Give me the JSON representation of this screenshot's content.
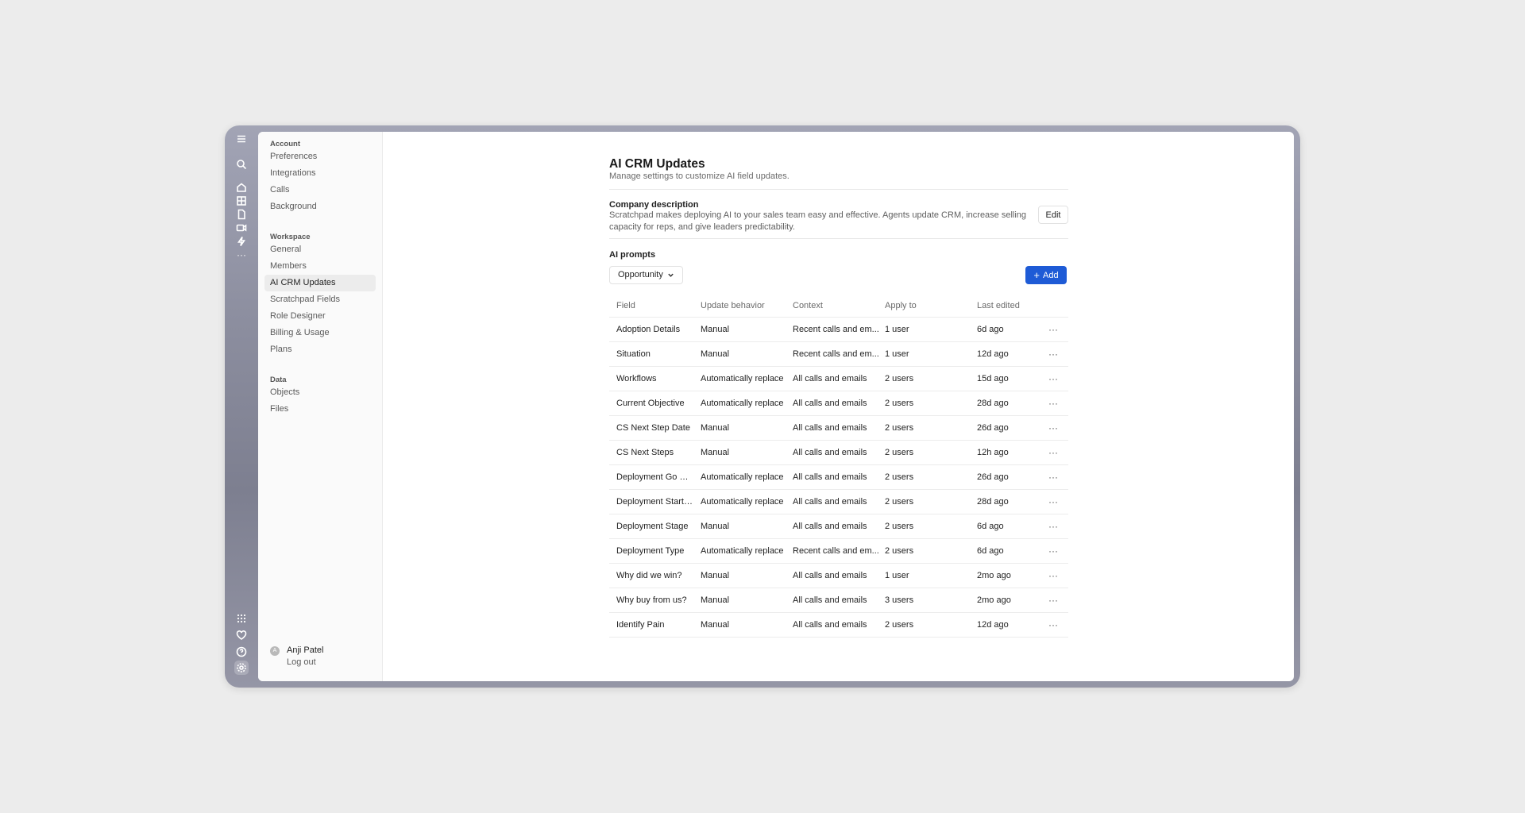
{
  "rail": {
    "icons": [
      "menu-icon",
      "search-icon",
      "home-icon",
      "grid-icon",
      "document-icon",
      "video-icon",
      "bolt-icon",
      "more-icon",
      "apps-icon",
      "heart-icon",
      "help-icon",
      "settings-icon"
    ],
    "more_glyph": "···"
  },
  "nav": {
    "groups": [
      {
        "title": "Account",
        "items": [
          "Preferences",
          "Integrations",
          "Calls",
          "Background"
        ]
      },
      {
        "title": "Workspace",
        "items": [
          "General",
          "Members",
          "AI CRM Updates",
          "Scratchpad Fields",
          "Role Designer",
          "Billing & Usage",
          "Plans"
        ]
      },
      {
        "title": "Data",
        "items": [
          "Objects",
          "Files"
        ]
      }
    ],
    "active_item": "AI CRM Updates",
    "user": {
      "initial": "A",
      "name": "Anji Patel",
      "logout": "Log out"
    }
  },
  "page": {
    "title": "AI CRM Updates",
    "subtitle": "Manage settings to customize AI field updates.",
    "company": {
      "label": "Company description",
      "text": "Scratchpad makes deploying AI to your sales team easy and effective. Agents update CRM, increase selling capacity for reps, and give leaders predictability.",
      "edit_label": "Edit"
    },
    "prompts_label": "AI prompts",
    "filter_value": "Opportunity",
    "add_label": "Add"
  },
  "table": {
    "headers": {
      "field": "Field",
      "update": "Update behavior",
      "context": "Context",
      "apply": "Apply to",
      "edited": "Last edited"
    },
    "more_glyph": "···",
    "rows": [
      {
        "field": "Adoption Details",
        "update": "Manual",
        "context": "Recent calls and em...",
        "apply": "1 user",
        "edited": "6d ago"
      },
      {
        "field": "Situation",
        "update": "Manual",
        "context": "Recent calls and em...",
        "apply": "1 user",
        "edited": "12d ago"
      },
      {
        "field": "Workflows",
        "update": "Automatically replace",
        "context": "All calls and emails",
        "apply": "2 users",
        "edited": "15d ago"
      },
      {
        "field": "Current Objective",
        "update": "Automatically replace",
        "context": "All calls and emails",
        "apply": "2 users",
        "edited": "28d ago"
      },
      {
        "field": "CS Next Step Date",
        "update": "Manual",
        "context": "All calls and emails",
        "apply": "2 users",
        "edited": "26d ago"
      },
      {
        "field": "CS Next Steps",
        "update": "Manual",
        "context": "All calls and emails",
        "apply": "2 users",
        "edited": "12h ago"
      },
      {
        "field": "Deployment Go Li...",
        "update": "Automatically replace",
        "context": "All calls and emails",
        "apply": "2 users",
        "edited": "26d ago"
      },
      {
        "field": "Deployment Start ...",
        "update": "Automatically replace",
        "context": "All calls and emails",
        "apply": "2 users",
        "edited": "28d ago"
      },
      {
        "field": "Deployment Stage",
        "update": "Manual",
        "context": "All calls and emails",
        "apply": "2 users",
        "edited": "6d ago"
      },
      {
        "field": "Deployment Type",
        "update": "Automatically replace",
        "context": "Recent calls and em...",
        "apply": "2 users",
        "edited": "6d ago"
      },
      {
        "field": "Why did we win?",
        "update": "Manual",
        "context": "All calls and emails",
        "apply": "1 user",
        "edited": "2mo ago"
      },
      {
        "field": "Why buy from us?",
        "update": "Manual",
        "context": "All calls and emails",
        "apply": "3 users",
        "edited": "2mo ago"
      },
      {
        "field": "Identify Pain",
        "update": "Manual",
        "context": "All calls and emails",
        "apply": "2 users",
        "edited": "12d ago"
      }
    ]
  },
  "colors": {
    "accent": "#1e5bd6",
    "rail": "#8c8e9f",
    "active_nav": "#ececec"
  }
}
